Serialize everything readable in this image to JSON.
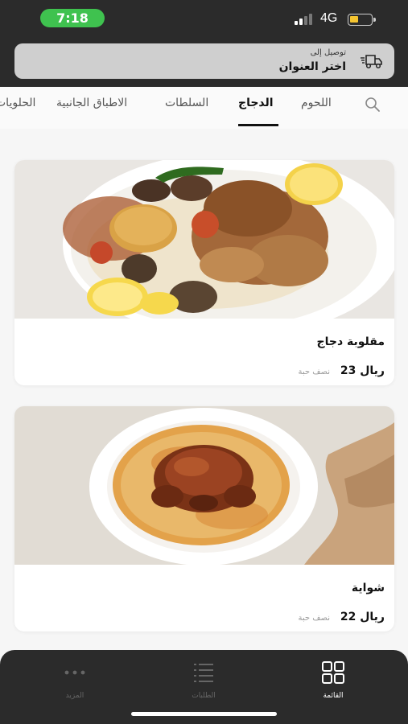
{
  "status_bar": {
    "time": "7:18",
    "network": "4G",
    "battery_level": 0.4,
    "time_pill_color": "#3fc24f"
  },
  "address_bar": {
    "delivery_to": "توصيل إلى",
    "choose_address": "اختر العنوان",
    "icon": "delivery-truck-icon"
  },
  "categories": {
    "search_icon": "search-icon",
    "items": [
      {
        "label": "اللحوم",
        "active": false
      },
      {
        "label": "الدجاج",
        "active": true
      },
      {
        "label": "السلطات",
        "active": false
      },
      {
        "label": "الاطباق الجانبية",
        "active": false
      },
      {
        "label": "الحلويات",
        "active": false
      }
    ]
  },
  "products": [
    {
      "name": "مقلوبة دجاج",
      "price": "23 ريال",
      "unit": "نصف حبة",
      "image": "maqluba-chicken-plate"
    },
    {
      "name": "شواية",
      "price": "22 ريال",
      "unit": "نصف حبة",
      "image": "grilled-chicken-rice-plate"
    }
  ],
  "bottom_nav": {
    "items": [
      {
        "label": "القائمة",
        "icon": "grid-icon",
        "active": true
      },
      {
        "label": "الطلبات",
        "icon": "list-icon",
        "active": false
      },
      {
        "label": "المزيد",
        "icon": "more-dots-icon",
        "active": false
      }
    ]
  },
  "colors": {
    "header_bg": "#2b2b2b",
    "address_bg": "#cfcfcf",
    "page_bg": "#f6f6f6",
    "accent": "#111111"
  }
}
